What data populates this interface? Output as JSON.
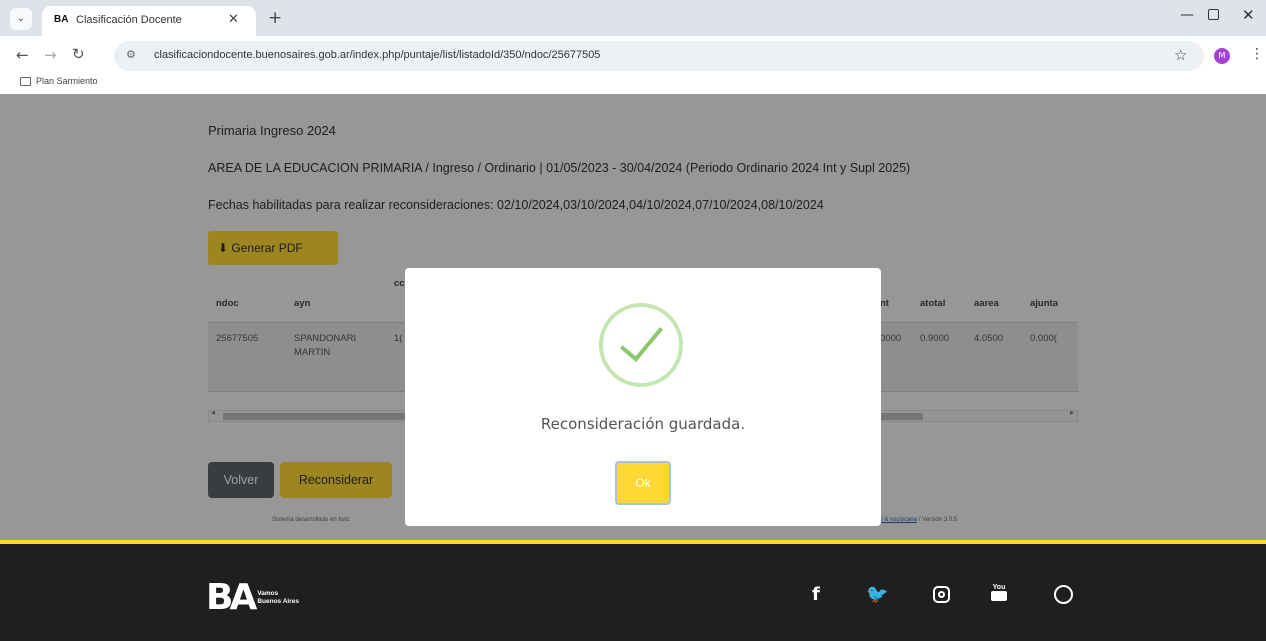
{
  "browser": {
    "tab_title": "Clasificación Docente",
    "tab_favicon": "BA",
    "url": "clasificaciondocente.buenosaires.gob.ar/index.php/puntaje/list/listadoId/350/ndoc/25677505",
    "profile_initial": "M",
    "bookmark": "Plan Sarmiento"
  },
  "page": {
    "heading": "Primaria Ingreso 2024",
    "period": "AREA DE LA EDUCACION PRIMARIA / Ingreso / Ordinario | 01/05/2023 - 30/04/2024 (Periodo Ordinario 2024 Int y Supl 2025)",
    "dates": "Fechas habilitadas para realizar reconsideraciones: 02/10/2024,03/10/2024,04/10/2024,07/10/2024,08/10/2024",
    "pdf_button": "Generar PDF",
    "table": {
      "headers": [
        "ndoc",
        "ayn",
        "cc",
        "nt",
        "atotal",
        "aarea",
        "ajunta"
      ],
      "row": [
        "25677505",
        "SPANDONARI MARTIN",
        "1(",
        "0000",
        "0.9000",
        "4.0500",
        "0.000("
      ]
    },
    "back_button": "Volver",
    "reconsider_button": "Reconsiderar",
    "footnote_left": "Sistema desarrollado en func",
    "footnote_link": "ral & sociocana",
    "footnote_version": " / Versión 3.0.5"
  },
  "modal": {
    "message": "Reconsideración guardada.",
    "ok_button": "Ok"
  },
  "footer": {
    "logo_mark": "BA",
    "logo_text": "Vamos Buenos Aires",
    "social": [
      "facebook",
      "twitter",
      "instagram",
      "youtube",
      "whatsapp"
    ]
  },
  "colors": {
    "accent": "#fdd835",
    "footer_bg": "#1f1f1f",
    "success": "#8cc76a"
  }
}
